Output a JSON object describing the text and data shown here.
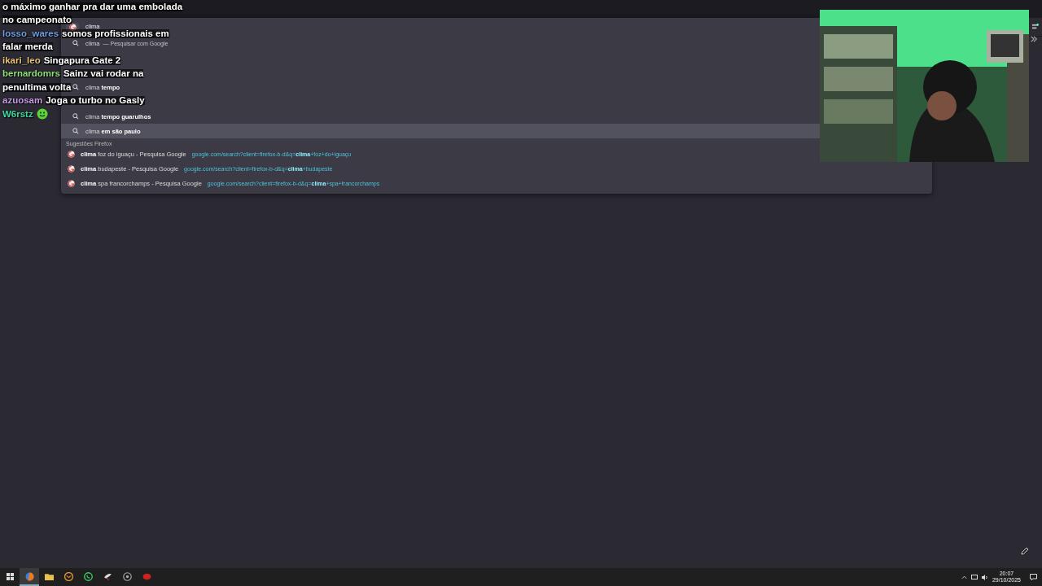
{
  "browser": {
    "address_bar": {
      "value": "clima"
    },
    "suggestions": [
      {
        "kind": "search",
        "query": "clima",
        "action": "— Pesquisar com Google",
        "selected": false
      },
      {
        "kind": "covered"
      },
      {
        "kind": "covered"
      },
      {
        "kind": "search",
        "query": "clima **tempo**",
        "selected": false
      },
      {
        "kind": "covered"
      },
      {
        "kind": "search",
        "query": "clima **tempo guarulhos**",
        "selected": false
      },
      {
        "kind": "search",
        "query": "clima **em são paulo**",
        "selected": true
      }
    ],
    "firefox_section": {
      "heading": "Sugestões Firefox",
      "items": [
        {
          "title": "**clima** foz do iguaçu - Pesquisa Google",
          "url": "google.com/search?client=firefox-b-d&q=**clima**+foz+do+iguaçu"
        },
        {
          "title": "**clima** budapeste - Pesquisa Google",
          "url": "google.com/search?client=firefox-b-d&q=**clima**+budapeste"
        },
        {
          "title": "**clima** spa francorchamps - Pesquisa Google",
          "url": "google.com/search?client=firefox-b-d&q=**clima**+spa+francorchamps"
        }
      ]
    }
  },
  "chat": [
    {
      "lines": [
        "o máximo ganhar pra dar uma embolada",
        "no campeonato"
      ]
    },
    {
      "user": "losso_wares",
      "color": "#6f9fe0",
      "lines": [
        "somos profissionais em",
        "falar merda"
      ]
    },
    {
      "user": "ikari_leo",
      "color": "#e8c27a",
      "lines": [
        "Singapura Gate 2"
      ]
    },
    {
      "user": "bernardomrs",
      "color": "#8fe07a",
      "lines": [
        "Sainz vai rodar na",
        "penultima volta"
      ]
    },
    {
      "user": "azuosam",
      "color": "#c79be8",
      "lines": [
        "Joga o turbo no Gasly"
      ]
    },
    {
      "user": "W6rstz",
      "color": "#3fd8a0",
      "emote": true
    }
  ],
  "taskbar": {
    "apps": [
      {
        "kind": "firefox",
        "selected": true
      },
      {
        "kind": "folder",
        "selected": false
      },
      {
        "kind": "mail",
        "selected": false
      },
      {
        "kind": "whatsapp",
        "selected": false
      },
      {
        "kind": "bird",
        "selected": false
      },
      {
        "kind": "circle",
        "selected": false
      },
      {
        "kind": "red",
        "selected": false
      }
    ],
    "time": "20:07",
    "date": "29/10/2025"
  }
}
